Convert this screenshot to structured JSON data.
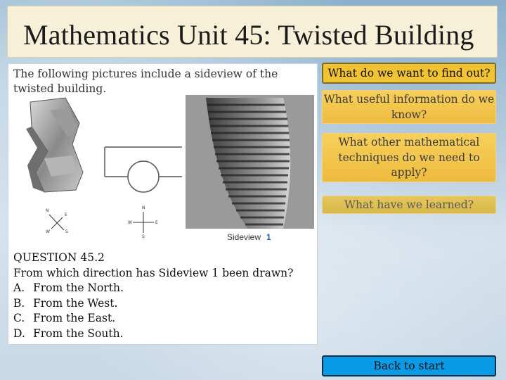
{
  "slide": {
    "title": "Mathematics Unit 45: Twisted Building"
  },
  "content": {
    "intro": "The following pictures include a sideview of the twisted building.",
    "figure": {
      "sideview_caption": "Sideview",
      "sideview_number": "1",
      "compass_left": {
        "n": "N",
        "e": "E",
        "w": "W",
        "s": "S"
      },
      "compass_right": {
        "n": "N",
        "e": "E",
        "w": "W",
        "s": "S"
      }
    },
    "question": {
      "heading": "QUESTION 45.2",
      "prompt": "From which direction has Sideview 1 been drawn?",
      "options": [
        {
          "letter": "A.",
          "text": "From the North."
        },
        {
          "letter": "B.",
          "text": "From the West."
        },
        {
          "letter": "C.",
          "text": "From the East."
        },
        {
          "letter": "D.",
          "text": "From the South."
        }
      ]
    }
  },
  "sidebar": {
    "q1": "What do we want to find out?",
    "q2": "What useful information do we know?",
    "q3": "What other mathematical techniques do we need to apply?",
    "q4": "What have we learned?",
    "back": "Back to start"
  },
  "colors": {
    "title_bg": "#f6f0d8",
    "button_gold": "#f1c232",
    "button_blue": "#0b9ae6"
  }
}
